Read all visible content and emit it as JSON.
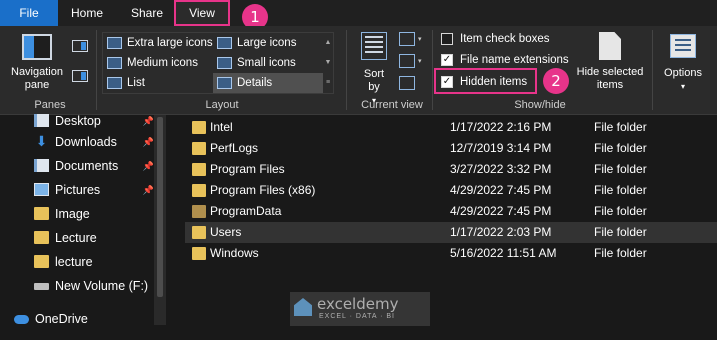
{
  "tabs": {
    "file": "File",
    "home": "Home",
    "share": "Share",
    "view": "View"
  },
  "badges": {
    "one": "1",
    "two": "2"
  },
  "panes": {
    "nav_pane_label": "Navigation pane",
    "group_label": "Panes"
  },
  "layout": {
    "group_label": "Layout",
    "items": [
      "Extra large icons",
      "Large icons",
      "Medium icons",
      "Small icons",
      "List",
      "Details"
    ],
    "selected": "Details"
  },
  "current_view": {
    "sort_by_label": "Sort by",
    "group_label": "Current view"
  },
  "show_hide": {
    "group_label": "Show/hide",
    "item_check_boxes": {
      "label": "Item check boxes",
      "checked": false
    },
    "file_name_extensions": {
      "label": "File name extensions",
      "checked": true
    },
    "hidden_items": {
      "label": "Hidden items",
      "checked": true
    },
    "hide_selected_label": "Hide selected items"
  },
  "options_label": "Options",
  "sidebar": {
    "items": [
      {
        "label": "Desktop",
        "icon": "desktop-icon",
        "pinned": true
      },
      {
        "label": "Downloads",
        "icon": "download-icon",
        "pinned": true
      },
      {
        "label": "Documents",
        "icon": "document-icon",
        "pinned": true
      },
      {
        "label": "Pictures",
        "icon": "pictures-icon",
        "pinned": true
      },
      {
        "label": "Image",
        "icon": "folder-icon",
        "pinned": false
      },
      {
        "label": "Lecture",
        "icon": "folder-icon",
        "pinned": false
      },
      {
        "label": "lecture",
        "icon": "folder-icon",
        "pinned": false
      },
      {
        "label": "New Volume (F:)",
        "icon": "drive-icon",
        "pinned": false
      },
      {
        "label": "OneDrive",
        "icon": "onedrive-icon",
        "pinned": false
      }
    ]
  },
  "files": [
    {
      "name": "Intel",
      "date": "1/17/2022 2:16 PM",
      "type": "File folder",
      "hidden": false
    },
    {
      "name": "PerfLogs",
      "date": "12/7/2019 3:14 PM",
      "type": "File folder",
      "hidden": false
    },
    {
      "name": "Program Files",
      "date": "3/27/2022 3:32 PM",
      "type": "File folder",
      "hidden": false
    },
    {
      "name": "Program Files (x86)",
      "date": "4/29/2022 7:45 PM",
      "type": "File folder",
      "hidden": false
    },
    {
      "name": "ProgramData",
      "date": "4/29/2022 7:45 PM",
      "type": "File folder",
      "hidden": true
    },
    {
      "name": "Users",
      "date": "1/17/2022 2:03 PM",
      "type": "File folder",
      "hidden": false
    },
    {
      "name": "Windows",
      "date": "5/16/2022 11:51 AM",
      "type": "File folder",
      "hidden": false
    }
  ],
  "selected_file": "Users",
  "watermark": {
    "name": "exceldemy",
    "tagline": "EXCEL · DATA · BI"
  },
  "colors": {
    "accent": "#1a6fc9",
    "highlight": "#e7348a",
    "folder": "#e8c25a"
  }
}
